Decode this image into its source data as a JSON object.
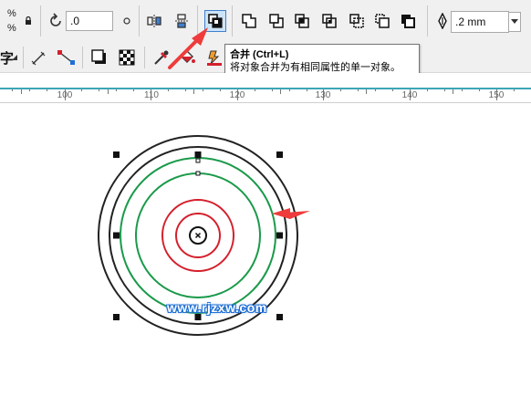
{
  "toolbar": {
    "percent_top": "%",
    "percent_bottom": "%",
    "rotation_value": ".0",
    "outline_width_value": ".2 mm",
    "text_tool_label": "字"
  },
  "ruler": {
    "ticks": [
      "100",
      "110",
      "120",
      "130",
      "140",
      "150"
    ]
  },
  "tooltip": {
    "title": "合并 (Ctrl+L)",
    "description": "将对象合并为有相同属性的单一对象。"
  },
  "watermark": {
    "text": "www.rjzxw.com"
  },
  "colors": {
    "annotation_arrow": "#ef3b3b",
    "ring_black": "#222222",
    "ring_green": "#1a9a4a",
    "ring_red": "#d4202c",
    "ruler_accent": "#3da5b8",
    "active_button_border": "#3f7fcf"
  }
}
